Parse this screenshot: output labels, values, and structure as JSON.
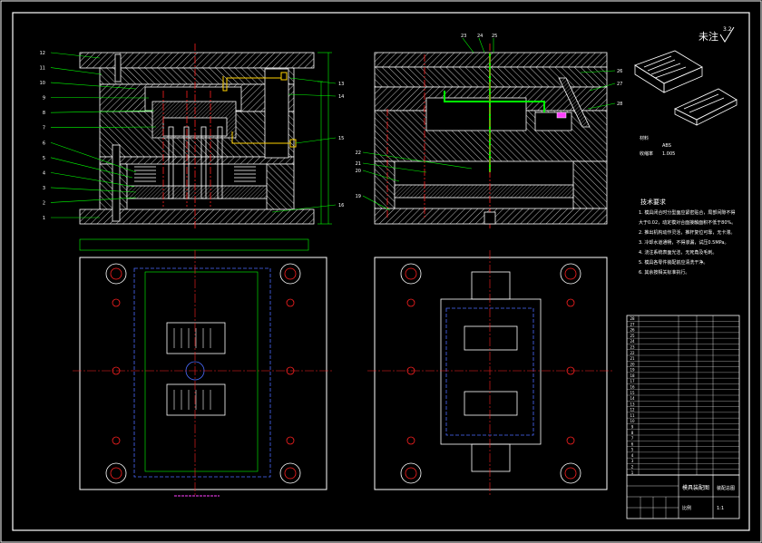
{
  "drawing": {
    "unmarked_note": "未注",
    "roughness_value": "3.2",
    "background_color": "#000000",
    "frame_color": "#ffffff",
    "hatch_color": "#c8c8c8",
    "leader_color": "#00ff00",
    "centerline_color": "#ff2020",
    "hidden_color": "#4a6bff",
    "accent_magenta": "#ff40ff",
    "accent_yellow": "#ffd200"
  },
  "front_section": {
    "left_callouts": [
      "12",
      "11",
      "10",
      "9",
      "8",
      "7",
      "6",
      "5",
      "4",
      "3",
      "2",
      "1"
    ],
    "right_callouts": [
      "13",
      "14",
      "15",
      "16"
    ]
  },
  "side_section": {
    "top_callouts": [
      "23",
      "24",
      "25"
    ],
    "right_callouts": [
      "26",
      "27",
      "28"
    ],
    "left_callouts": [
      "22",
      "21",
      "20",
      "19"
    ]
  },
  "part_sketch": {
    "material_label": "材料",
    "material_value": "ABS",
    "shrink_label": "收缩率",
    "shrink_value": "1.005"
  },
  "tech_notes": {
    "title": "技术要求",
    "lines": [
      "1. 模具闭合时分型面应紧密贴合，局部间隙不得",
      "大于0.02，动定模对合面接触面积不低于80%。",
      "2. 推出机构动作灵活，推杆复位可靠，无卡滞。",
      "3. 冷却水道通畅，不得渗漏，试压0.5MPa。",
      "4. 浇注系统表面光洁，无死角及毛刺。",
      "5. 模具各零件装配前应清洗干净。",
      "6. 其余按相关标准执行。"
    ]
  },
  "title_block": {
    "drawing_title": "模具装配图",
    "drawing_no": "装配总图",
    "scale_label": "比例",
    "scale_value": "1:1"
  },
  "bom": {
    "rows": [
      [
        "28",
        "",
        "",
        "",
        ""
      ],
      [
        "27",
        "",
        "",
        "",
        ""
      ],
      [
        "26",
        "",
        "",
        "",
        ""
      ],
      [
        "25",
        "",
        "",
        "",
        ""
      ],
      [
        "24",
        "",
        "",
        "",
        ""
      ],
      [
        "23",
        "",
        "",
        "",
        ""
      ],
      [
        "22",
        "",
        "",
        "",
        ""
      ],
      [
        "21",
        "",
        "",
        "",
        ""
      ],
      [
        "20",
        "",
        "",
        "",
        ""
      ],
      [
        "19",
        "",
        "",
        "",
        ""
      ],
      [
        "18",
        "",
        "",
        "",
        ""
      ],
      [
        "17",
        "",
        "",
        "",
        ""
      ],
      [
        "16",
        "",
        "",
        "",
        ""
      ],
      [
        "15",
        "",
        "",
        "",
        ""
      ],
      [
        "14",
        "",
        "",
        "",
        ""
      ],
      [
        "13",
        "",
        "",
        "",
        ""
      ],
      [
        "12",
        "",
        "",
        "",
        ""
      ],
      [
        "11",
        "",
        "",
        "",
        ""
      ],
      [
        "10",
        "",
        "",
        "",
        ""
      ],
      [
        "9",
        "",
        "",
        "",
        ""
      ],
      [
        "8",
        "",
        "",
        "",
        ""
      ],
      [
        "7",
        "",
        "",
        "",
        ""
      ],
      [
        "6",
        "",
        "",
        "",
        ""
      ],
      [
        "5",
        "",
        "",
        "",
        ""
      ],
      [
        "4",
        "",
        "",
        "",
        ""
      ],
      [
        "3",
        "",
        "",
        "",
        ""
      ],
      [
        "2",
        "",
        "",
        "",
        ""
      ],
      [
        "1",
        "",
        "",
        "",
        ""
      ]
    ]
  }
}
